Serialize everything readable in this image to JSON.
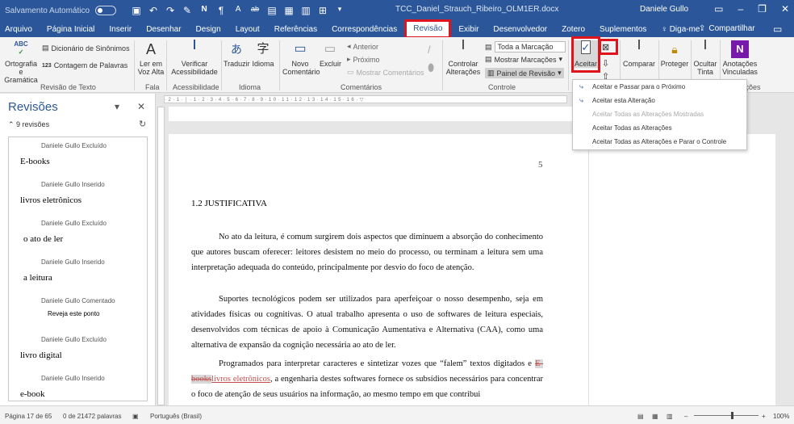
{
  "titlebar": {
    "autosave_label": "Salvamento Automático",
    "doc_title": "TCC_Daniel_Strauch_Ribeiro_OLM1ER.docx",
    "user": "Daniele Gullo"
  },
  "tabs": [
    "Arquivo",
    "Página Inicial",
    "Inserir",
    "Desenhar",
    "Design",
    "Layout",
    "Referências",
    "Correspondências",
    "Revisão",
    "Exibir",
    "Desenvolvedor",
    "Zotero",
    "Suplementos",
    "Diga-me"
  ],
  "share_label": "Compartilhar",
  "ribbon": {
    "spelling": "Ortografia e Gramática",
    "thesaurus": "Dicionário de Sinônimos",
    "word_count": "Contagem de Palavras",
    "group_proofing": "Revisão de Texto",
    "read_aloud": "Ler em Voz Alta",
    "group_speech": "Fala",
    "check_access": "Verificar Acessibilidade",
    "group_access": "Acessibilidade",
    "translate": "Traduzir",
    "language": "Idioma",
    "group_language": "Idioma",
    "new_comment": "Novo Comentário",
    "delete": "Excluir",
    "previous": "Anterior",
    "next": "Próximo",
    "show_comments": "Mostrar Comentários",
    "group_comments": "Comentários",
    "track_changes": "Controlar Alterações",
    "markup_select": "Toda a Marcação",
    "show_markup": "Mostrar Marcações",
    "review_pane": "Painel de Revisão",
    "group_tracking": "Controle",
    "accept": "Aceitar",
    "compare": "Comparar",
    "protect": "Proteger",
    "hide_ink": "Ocultar Tinta",
    "linked_notes": "Anotações Vinculadas",
    "group_notes": "Anotações"
  },
  "accept_menu": [
    {
      "label": "Aceitar e Passar para o Próximo",
      "enabled": true
    },
    {
      "label": "Aceitar esta Alteração",
      "enabled": true
    },
    {
      "label": "Aceitar Todas as Alterações Mostradas",
      "enabled": false
    },
    {
      "label": "Aceitar Todas as Alterações",
      "enabled": true
    },
    {
      "label": "Aceitar Todas as Alterações e Parar o Controle",
      "enabled": true
    }
  ],
  "panel": {
    "title": "Revisões",
    "count": "9 revisões",
    "items": [
      {
        "author": "Daniele Gullo Excluído",
        "text": "E-books"
      },
      {
        "author": "Daniele Gullo Inserido",
        "text": "livros eletrônicos"
      },
      {
        "author": "Daniele Gullo Excluído",
        "text": "o ato de ler"
      },
      {
        "author": "Daniele Gullo Inserido",
        "text": "a leitura"
      },
      {
        "author": "Daniele Gullo Comentado",
        "text": "Reveja este ponto"
      },
      {
        "author": "Daniele Gullo Excluído",
        "text": "livro digital"
      },
      {
        "author": "Daniele Gullo Inserido",
        "text": "e-book"
      }
    ]
  },
  "document": {
    "page_number": "5",
    "heading": "1.2 JUSTIFICATIVA",
    "p1": "No ato da leitura, é comum surgirem dois aspectos que diminuem a absorção do conhecimento que autores buscam oferecer: leitores desistem no meio do processo, ou terminam a leitura sem uma interpretação adequada do conteúdo, principalmente por desvio do foco de atenção.",
    "p2": "Suportes tecnológicos podem ser utilizados para aperfeiçoar o nosso desempenho, seja em atividades físicas ou cognitivas. O atual trabalho apresenta o uso de softwares de leitura especiais, desenvolvidos com técnicas de apoio à Comunicação Aumentativa e Alternativa (CAA), como uma alternativa de expansão da cognição necessária ao ato de ler.",
    "p3_a": "Programados para interpretar caracteres e sintetizar vozes que “falem” textos digitados e ",
    "p3_del": "E-books",
    "p3_ins": "livros eletrônicos",
    "p3_b": ", a engenharia destes softwares fornece os subsídios necessários para concentrar o foco de atenção de seus usuários na informação, ao mesmo tempo em que contribui"
  },
  "status": {
    "page": "Página 17 de 65",
    "words": "0 de 21472 palavras",
    "language": "Português (Brasil)",
    "zoom": "100%"
  }
}
